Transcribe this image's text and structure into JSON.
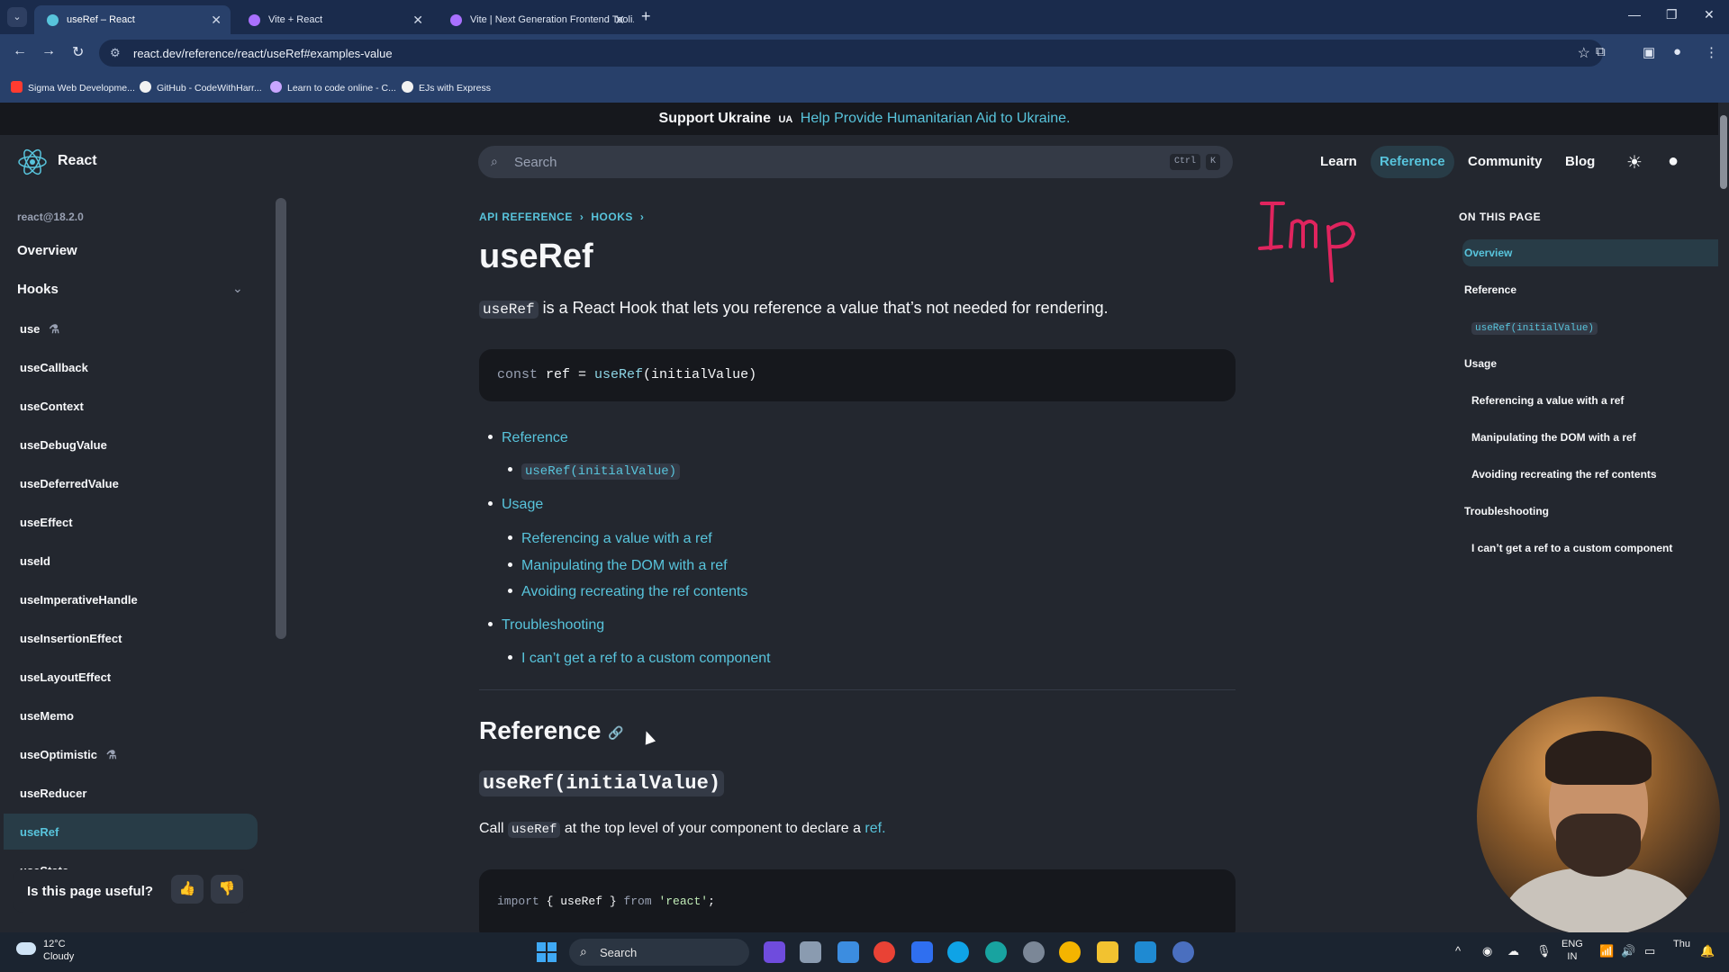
{
  "browser": {
    "tabs": [
      {
        "title": "useRef – React",
        "active": true
      },
      {
        "title": "Vite + React",
        "active": false
      },
      {
        "title": "Vite | Next Generation Frontend Tooli...",
        "active": false
      }
    ],
    "url": "react.dev/reference/react/useRef#examples-value",
    "bookmarks": [
      {
        "label": "Sigma Web Developme...",
        "icon": "youtube-icon"
      },
      {
        "label": "GitHub - CodeWithHarr...",
        "icon": "github-icon"
      },
      {
        "label": "Learn to code online - C...",
        "icon": "codecademy-icon"
      },
      {
        "label": "EJs with Express",
        "icon": "github-icon"
      }
    ]
  },
  "banner": {
    "bold": "Support Ukraine",
    "flag": "UA",
    "link": "Help Provide Humanitarian Aid to Ukraine."
  },
  "header": {
    "brand": "React",
    "search_placeholder": "Search",
    "kbd_ctrl": "Ctrl",
    "kbd_k": "K",
    "nav": [
      "Learn",
      "Reference",
      "Community",
      "Blog"
    ],
    "active_nav": "Reference"
  },
  "sidebar": {
    "version": "react@18.2.0",
    "overview": "Overview",
    "section": "Hooks",
    "items": [
      "use",
      "useCallback",
      "useContext",
      "useDebugValue",
      "useDeferredValue",
      "useEffect",
      "useId",
      "useImperativeHandle",
      "useInsertionEffect",
      "useLayoutEffect",
      "useMemo",
      "useOptimistic",
      "useReducer",
      "useRef",
      "useState"
    ],
    "active_item": "useRef",
    "feedback_question": "Is this page useful?"
  },
  "main": {
    "breadcrumbs": [
      "API REFERENCE",
      "HOOKS"
    ],
    "title": "useRef",
    "lead_code": "useRef",
    "lead_text": " is a React Hook that lets you reference a value that’s not needed for rendering.",
    "signature": {
      "kw": "const",
      "rest1": " ref = ",
      "fn": "useRef",
      "rest2": "(initialValue)"
    },
    "toc": {
      "reference": "Reference",
      "reference_sub": "useRef(initialValue)",
      "usage": "Usage",
      "usage_items": [
        "Referencing a value with a ref",
        "Manipulating the DOM with a ref",
        "Avoiding recreating the ref contents"
      ],
      "troubleshooting": "Troubleshooting",
      "troubleshooting_items": [
        "I can’t get a ref to a custom component"
      ]
    },
    "h2": "Reference",
    "h3": "useRef(initialValue)",
    "para_pre": "Call ",
    "para_code": "useRef",
    "para_mid": " at the top level of your component to declare a ",
    "para_link": "ref.",
    "import_line": {
      "kw1": "import",
      "mid": " { useRef } ",
      "kw2": "from",
      "str": " 'react'",
      "end": ";"
    },
    "annotation": "Imp"
  },
  "right_toc": {
    "heading": "ON THIS PAGE",
    "items": [
      {
        "label": "Overview",
        "level": 0,
        "active": true
      },
      {
        "label": "Reference",
        "level": 0
      },
      {
        "label": "useRef(initialValue)",
        "level": 1,
        "code": true
      },
      {
        "label": "Usage",
        "level": 0
      },
      {
        "label": "Referencing a value with a ref",
        "level": 1
      },
      {
        "label": "Manipulating the DOM with a ref",
        "level": 1
      },
      {
        "label": "Avoiding recreating the ref contents",
        "level": 1
      },
      {
        "label": "Troubleshooting",
        "level": 0
      },
      {
        "label": "I can’t get a ref to a custom component",
        "level": 1
      }
    ]
  },
  "taskbar": {
    "temp": "12°C",
    "weather": "Cloudy",
    "search": "Search",
    "lang": "ENG",
    "region": "IN",
    "day": "Thu"
  },
  "colors": {
    "accent": "#58c4dc",
    "bg": "#23272f",
    "code_bg": "#16181d",
    "annotation": "#e0245e"
  }
}
